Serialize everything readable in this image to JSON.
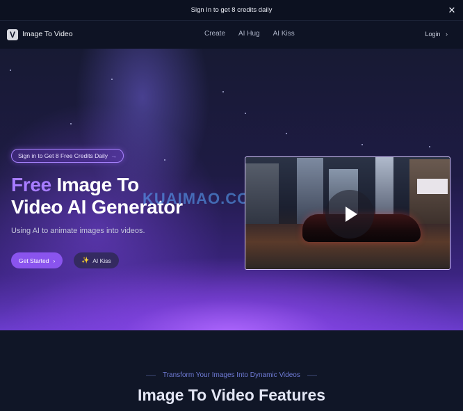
{
  "top_banner": {
    "text": "Sign In to get 8 credits daily",
    "close_icon": "✕"
  },
  "nav": {
    "logo_letter": "V",
    "brand": "Image To Video",
    "links": [
      "Create",
      "AI Hug",
      "AI Kiss"
    ],
    "login": "Login",
    "login_chevron": "›"
  },
  "hero": {
    "pill_text": "Sign in to Get 8 Free Credits Daily",
    "pill_arrow": "→",
    "headline_accent": "Free",
    "headline_rest_1": "Image To",
    "headline_line_2": "Video AI Generator",
    "subtitle": "Using AI to animate images into videos.",
    "primary_button": "Get Started",
    "primary_chevron": "›",
    "secondary_button": "AI Kiss",
    "secondary_icon": "✨",
    "watermark": "KUAIMAO.COM"
  },
  "features": {
    "eyebrow": "Transform Your Images Into Dynamic Videos",
    "title": "Image To Video Features"
  },
  "colors": {
    "accent": "#a77cff",
    "button_primary": "#8a54ee",
    "background": "#0d1222"
  }
}
